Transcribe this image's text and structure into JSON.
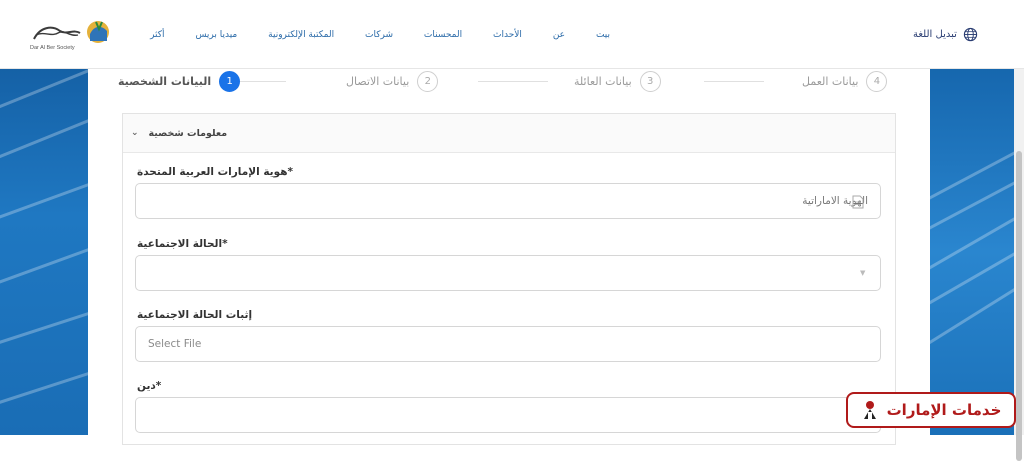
{
  "header": {
    "language_switch": "تبديل اللغة",
    "nav": [
      "أكثر",
      "ميديا بريس",
      "المكتبة الإلكترونية",
      "شركات",
      "المحسنات",
      "الأحداث",
      "عن",
      "بيت"
    ],
    "logo_text": "Dar Al Ber Society"
  },
  "stepper": {
    "steps": [
      {
        "number": "1",
        "label": "البيانات الشخصية",
        "active": true
      },
      {
        "number": "2",
        "label": "بيانات الاتصال",
        "active": false
      },
      {
        "number": "3",
        "label": "بيانات العائلة",
        "active": false
      },
      {
        "number": "4",
        "label": "بيانات العمل",
        "active": false
      }
    ]
  },
  "section": {
    "title": "معلومات شخصية"
  },
  "form": {
    "emirates_id": {
      "label": "*هوية الإمارات العربية المتحدة",
      "placeholder": "الهوية الاماراتية"
    },
    "marital_status": {
      "label": "*الحالة الاجتماعية",
      "value": ""
    },
    "marital_proof": {
      "label": "إثبات الحالة الاجتماعية",
      "placeholder": "Select File"
    },
    "religion": {
      "label": "*دين",
      "value": ""
    }
  },
  "watermark": {
    "text": "خدمات الإمارات"
  },
  "colors": {
    "accent": "#1a73e8",
    "nav": "#2a6aa8",
    "side_panel": "#1a6db5",
    "watermark": "#b01a1a"
  }
}
